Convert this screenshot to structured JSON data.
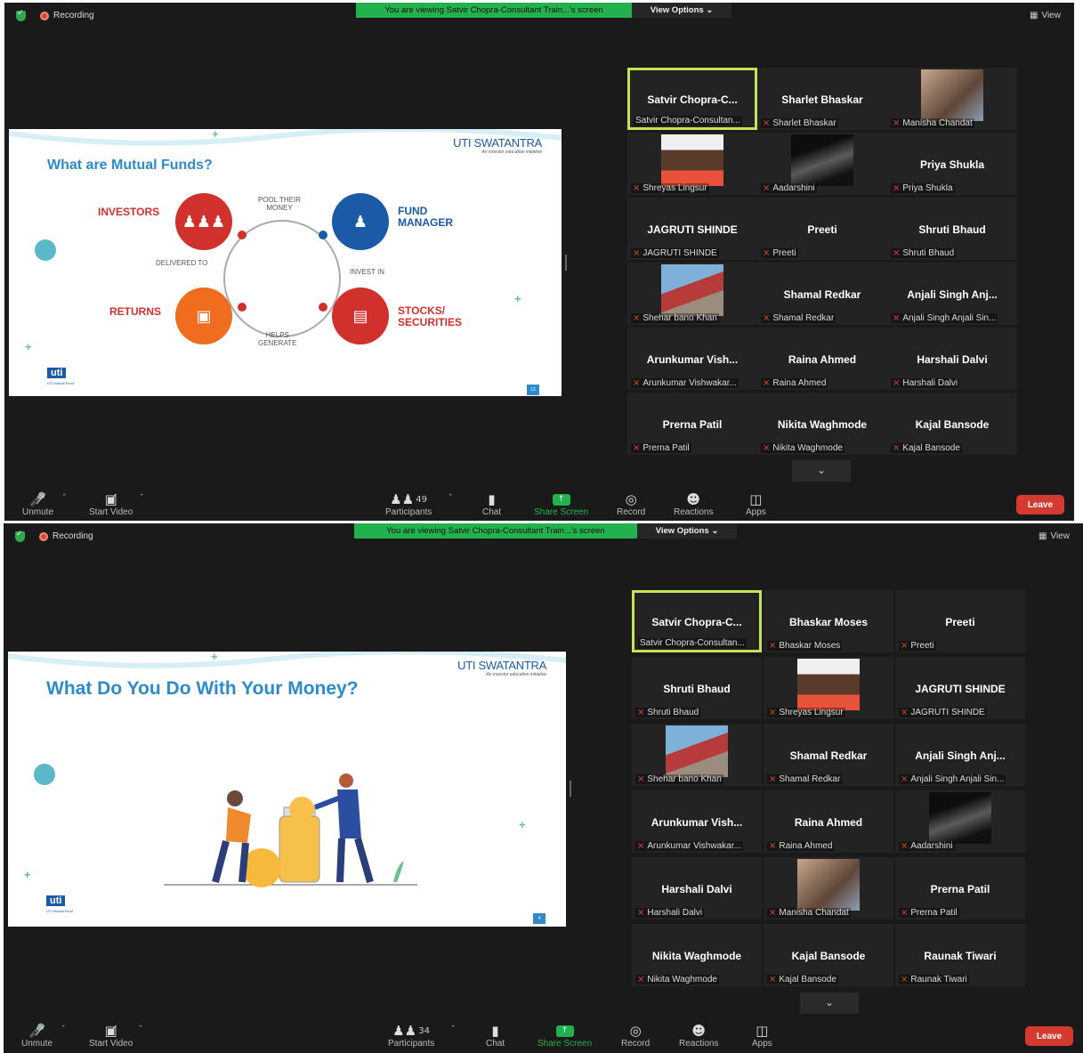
{
  "screens": [
    {
      "recording": "Recording",
      "viewing_banner": "You are viewing Satvir Chopra-Consultant Train...'s screen",
      "view_options": "View Options",
      "view": "View",
      "slide": {
        "title": "What are Mutual Funds?",
        "brand": "UTI SWATANTRA",
        "brand_tag": "An investor education initiative",
        "logo": "uti",
        "logo_sub": "UTI Mutual Fund",
        "page": "12",
        "investors": "INVESTORS",
        "fund_manager_1": "FUND",
        "fund_manager_2": "MANAGER",
        "returns": "RETURNS",
        "stocks_1": "STOCKS/",
        "stocks_2": "SECURITIES",
        "pool_1": "POOL THEIR",
        "pool_2": "MONEY",
        "invest_in": "INVEST IN",
        "helps_1": "HELPS",
        "helps_2": "GENERATE",
        "delivered": "DELIVERED TO"
      },
      "tiles": [
        {
          "big": "Satvir  Chopra-C...",
          "name": "Satvir Chopra-Consultan...",
          "muted": false,
          "active": true
        },
        {
          "big": "Sharlet Bhaskar",
          "name": "Sharlet Bhaskar",
          "muted": true
        },
        {
          "big": "",
          "name": "Manisha Chandat",
          "muted": true,
          "photo": "girl"
        },
        {
          "big": "",
          "name": "Shreyas Lingsur",
          "muted": true,
          "photo": "boy"
        },
        {
          "big": "",
          "name": "Aadarshini",
          "muted": true,
          "photo": "dark"
        },
        {
          "big": "Priya Shukla",
          "name": "Priya Shukla",
          "muted": true
        },
        {
          "big": "JAGRUTI SHINDE",
          "name": "JAGRUTI SHINDE",
          "muted": true
        },
        {
          "big": "Preeti",
          "name": "Preeti",
          "muted": true
        },
        {
          "big": "Shruti Bhaud",
          "name": "Shruti Bhaud",
          "muted": true
        },
        {
          "big": "",
          "name": "Shehar bano Khan",
          "muted": true,
          "photo": "flag"
        },
        {
          "big": "Shamal Redkar",
          "name": "Shamal Redkar",
          "muted": true
        },
        {
          "big": "Anjali Singh  Anj...",
          "name": "Anjali Singh Anjali Sin...",
          "muted": true
        },
        {
          "big": "Arunkumar  Vish...",
          "name": "Arunkumar Vishwakar...",
          "muted": true
        },
        {
          "big": "Raina Ahmed",
          "name": "Raina Ahmed",
          "muted": true
        },
        {
          "big": "Harshali Dalvi",
          "name": "Harshali Dalvi",
          "muted": true
        },
        {
          "big": "Prerna Patil",
          "name": "Prerna Patil",
          "muted": true
        },
        {
          "big": "Nikita Waghmode",
          "name": "Nikita Waghmode",
          "muted": true
        },
        {
          "big": "Kajal Bansode",
          "name": "Kajal Bansode",
          "muted": true
        }
      ],
      "toolbar": {
        "unmute": "Unmute",
        "start_video": "Start Video",
        "participants": "Participants",
        "participants_count": "49",
        "chat": "Chat",
        "share_screen": "Share Screen",
        "record": "Record",
        "reactions": "Reactions",
        "apps": "Apps",
        "leave": "Leave"
      }
    },
    {
      "recording": "Recording",
      "viewing_banner": "You are viewing Satvir Chopra-Consultant Train...'s screen",
      "view_options": "View Options",
      "view": "View",
      "slide": {
        "title": "What Do You Do With Your Money?",
        "brand": "UTI SWATANTRA",
        "brand_tag": "An investor education initiative",
        "logo": "uti",
        "logo_sub": "UTI Mutual Fund",
        "page": "4"
      },
      "tiles": [
        {
          "big": "Satvir  Chopra-C...",
          "name": "Satvir Chopra-Consultan...",
          "muted": false,
          "active": true
        },
        {
          "big": "Bhaskar Moses",
          "name": "Bhaskar Moses",
          "muted": true
        },
        {
          "big": "Preeti",
          "name": "Preeti",
          "muted": true
        },
        {
          "big": "Shruti Bhaud",
          "name": "Shruti Bhaud",
          "muted": true
        },
        {
          "big": "",
          "name": "Shreyas Lingsur",
          "muted": true,
          "photo": "boy"
        },
        {
          "big": "JAGRUTI SHINDE",
          "name": "JAGRUTI SHINDE",
          "muted": true
        },
        {
          "big": "",
          "name": "Shehar bano Khan",
          "muted": true,
          "photo": "flag"
        },
        {
          "big": "Shamal Redkar",
          "name": "Shamal Redkar",
          "muted": true
        },
        {
          "big": "Anjali Singh  Anj...",
          "name": "Anjali Singh Anjali Sin...",
          "muted": true
        },
        {
          "big": "Arunkumar  Vish...",
          "name": "Arunkumar Vishwakar...",
          "muted": true
        },
        {
          "big": "Raina Ahmed",
          "name": "Raina Ahmed",
          "muted": true
        },
        {
          "big": "",
          "name": "Aadarshini",
          "muted": true,
          "photo": "dark"
        },
        {
          "big": "Harshali Dalvi",
          "name": "Harshali Dalvi",
          "muted": true
        },
        {
          "big": "",
          "name": "Manisha Chandat",
          "muted": true,
          "photo": "girl"
        },
        {
          "big": "Prerna Patil",
          "name": "Prerna Patil",
          "muted": true
        },
        {
          "big": "Nikita Waghmode",
          "name": "Nikita Waghmode",
          "muted": true
        },
        {
          "big": "Kajal Bansode",
          "name": "Kajal Bansode",
          "muted": true
        },
        {
          "big": "Raunak Tiwari",
          "name": "Raunak Tiwari",
          "muted": true
        }
      ],
      "toolbar": {
        "unmute": "Unmute",
        "start_video": "Start Video",
        "participants": "Participants",
        "participants_count": "34",
        "chat": "Chat",
        "share_screen": "Share Screen",
        "record": "Record",
        "reactions": "Reactions",
        "apps": "Apps",
        "leave": "Leave"
      }
    }
  ],
  "colors": {
    "accent_green": "#23b14d",
    "active_speaker": "#c4e35a",
    "leave_red": "#d43a2f",
    "muted_red": "#e0442f"
  }
}
